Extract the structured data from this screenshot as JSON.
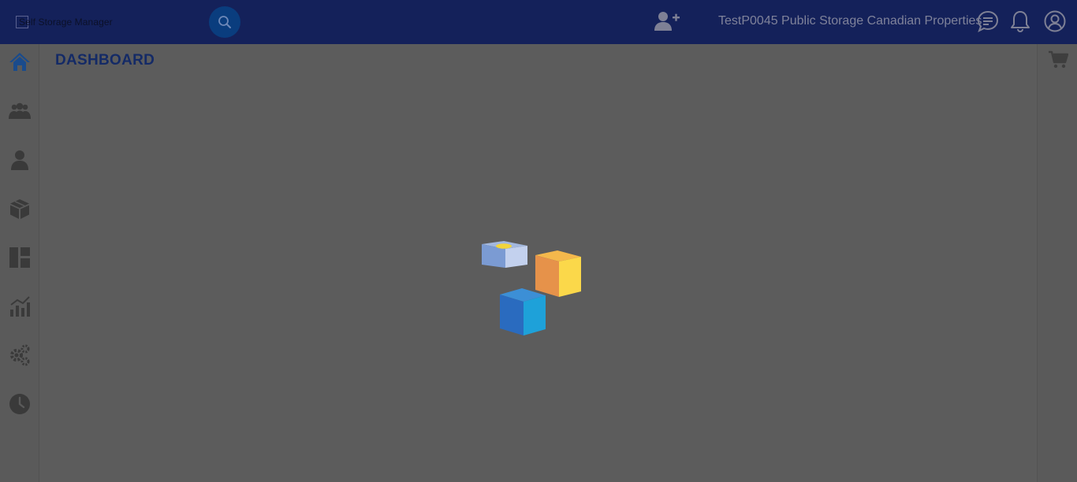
{
  "header": {
    "logo_alt": "Self Storage Manager",
    "facility_name": "TestP0045 Public Storage Canadian Properties",
    "icons": [
      "search-icon",
      "add-user-icon",
      "chat-icon",
      "bell-icon",
      "account-icon"
    ]
  },
  "page": {
    "title": "DASHBOARD"
  },
  "sidebar": {
    "items": [
      {
        "icon": "home-icon",
        "active": true
      },
      {
        "icon": "users-group-icon"
      },
      {
        "icon": "user-icon"
      },
      {
        "icon": "box-icon"
      },
      {
        "icon": "dashboard-layout-icon"
      },
      {
        "icon": "reports-chart-icon"
      },
      {
        "icon": "settings-gears-icon"
      },
      {
        "icon": "clock-icon"
      }
    ]
  },
  "right_panel": {
    "icons": [
      "cart-icon"
    ]
  },
  "loading_overlay": {
    "visible": true,
    "icon": "cubes-loader-icon"
  },
  "colors": {
    "header_bg": "#14215a",
    "overlay_bg": "#5c5c5c",
    "accent_blue": "#1a4b8c",
    "title_text": "#142a66"
  }
}
